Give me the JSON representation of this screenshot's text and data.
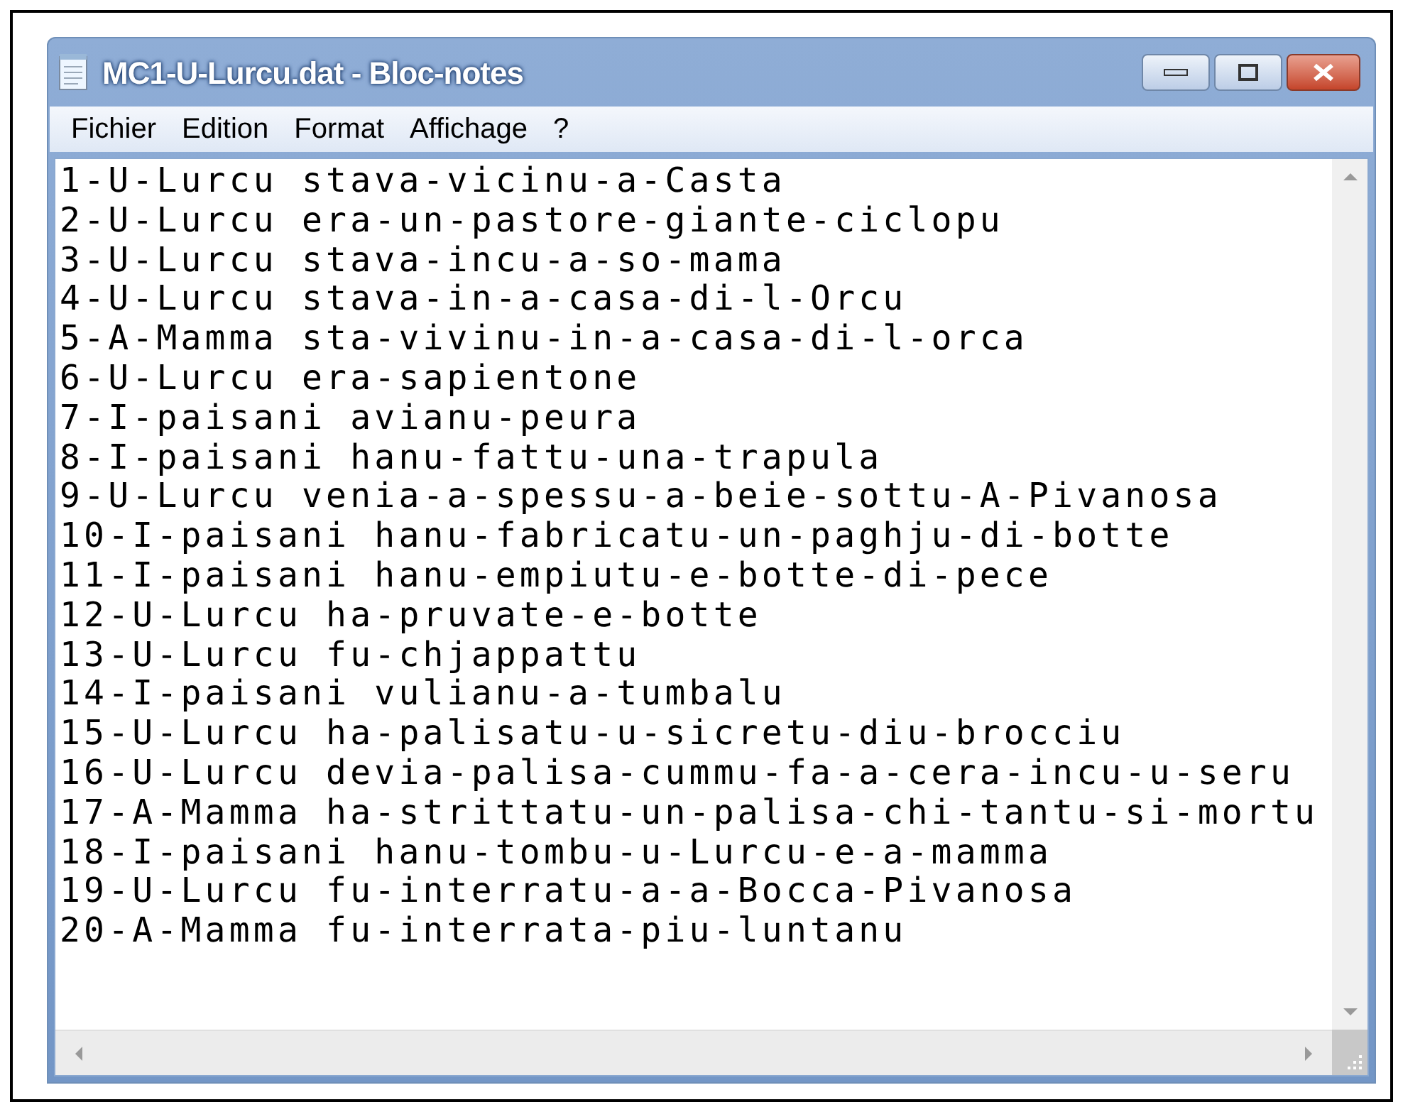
{
  "window": {
    "title": "MC1-U-Lurcu.dat - Bloc-notes"
  },
  "menu": [
    "Fichier",
    "Edition",
    "Format",
    "Affichage",
    "?"
  ],
  "lines": [
    "1-U-Lurcu stava-vicinu-a-Casta",
    "2-U-Lurcu era-un-pastore-giante-ciclopu",
    "3-U-Lurcu stava-incu-a-so-mama",
    "4-U-Lurcu stava-in-a-casa-di-l-Orcu",
    "5-A-Mamma sta-vivinu-in-a-casa-di-l-orca",
    "6-U-Lurcu era-sapientone",
    "7-I-paisani avianu-peura",
    "8-I-paisani hanu-fattu-una-trapula",
    "9-U-Lurcu venia-a-spessu-a-beie-sottu-A-Pivanosa",
    "10-I-paisani hanu-fabricatu-un-paghju-di-botte",
    "11-I-paisani hanu-empiutu-e-botte-di-pece",
    "12-U-Lurcu ha-pruvate-e-botte",
    "13-U-Lurcu fu-chjappattu",
    "14-I-paisani vulianu-a-tumbalu",
    "15-U-Lurcu ha-palisatu-u-sicretu-diu-brocciu",
    "16-U-Lurcu devia-palisa-cummu-fa-a-cera-incu-u-seru",
    "17-A-Mamma ha-strittatu-un-palisa-chi-tantu-si-mortu",
    "18-I-paisani hanu-tombu-u-Lurcu-e-a-mamma",
    "19-U-Lurcu fu-interratu-a-a-Bocca-Pivanosa",
    "20-A-Mamma fu-interrata-piu-luntanu"
  ]
}
